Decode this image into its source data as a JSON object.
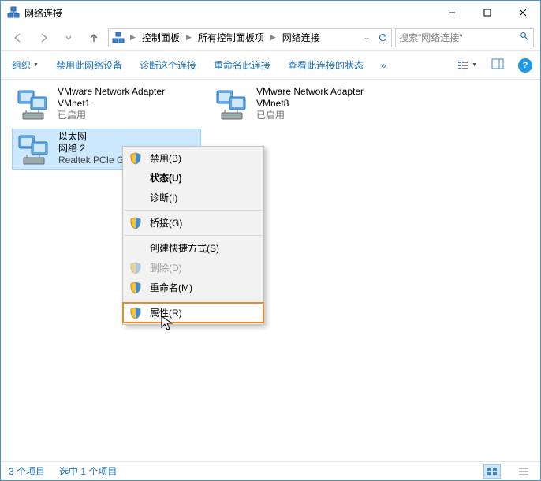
{
  "window": {
    "title": "网络连接"
  },
  "breadcrumb": {
    "parts": [
      "控制面板",
      "所有控制面板项",
      "网络连接"
    ]
  },
  "search": {
    "placeholder": "搜索\"网络连接\""
  },
  "toolbar": {
    "organize": "组织",
    "disable_device": "禁用此网络设备",
    "diagnose": "诊断这个连接",
    "rename": "重命名此连接",
    "view_status": "查看此连接的状态",
    "more": "»"
  },
  "items": [
    {
      "name": "VMware Network Adapter VMnet1",
      "line2": "",
      "status": "已启用"
    },
    {
      "name": "VMware Network Adapter VMnet8",
      "line2": "",
      "status": "已启用"
    },
    {
      "name": "以太网",
      "line2": "网络 2",
      "status": "Realtek PCIe G"
    }
  ],
  "context_menu": {
    "disable": "禁用(B)",
    "status": "状态(U)",
    "diagnose": "诊断(I)",
    "bridge": "桥接(G)",
    "shortcut": "创建快捷方式(S)",
    "delete": "删除(D)",
    "rename": "重命名(M)",
    "properties": "属性(R)"
  },
  "status_bar": {
    "count": "3 个项目",
    "selected": "选中 1 个项目"
  }
}
